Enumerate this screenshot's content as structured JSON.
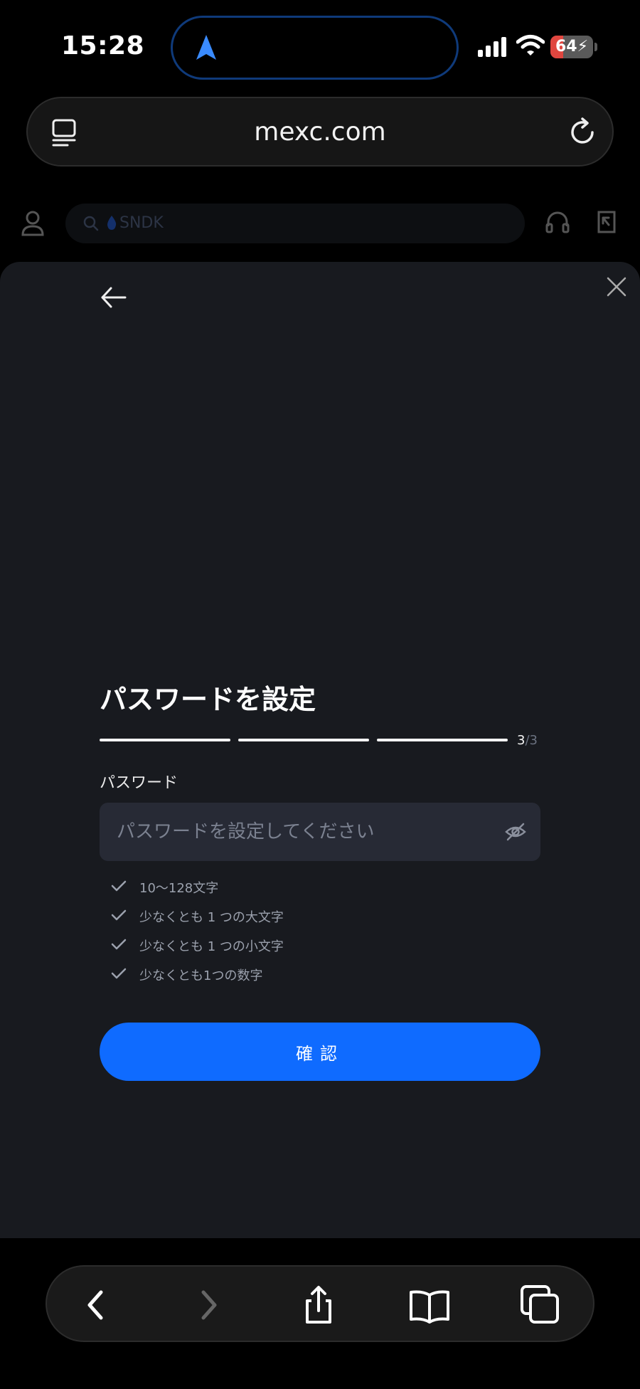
{
  "status_bar": {
    "time": "15:28",
    "battery": "64"
  },
  "browser": {
    "url": "mexc.com"
  },
  "site_header": {
    "search_hot_token": "SNDK"
  },
  "modal": {
    "title": "パスワードを設定",
    "step_current": "3",
    "step_total": "/3",
    "password_label": "パスワード",
    "password_placeholder": "パスワードを設定してください",
    "rules": [
      "10～128文字",
      "少なくとも 1 つの大文字",
      "少なくとも 1 つの小文字",
      "少なくとも1つの数字"
    ],
    "confirm_label": "確認"
  },
  "colors": {
    "accent": "#0f6bff",
    "modal_bg": "#181a1f",
    "field_bg": "#272a35",
    "island_border": "#0f3a7a"
  },
  "icons": [
    "navigation-arrow-icon",
    "signal-icon",
    "wifi-icon",
    "battery-icon",
    "tab-overview-icon",
    "reload-icon",
    "user-icon",
    "search-icon",
    "flame-icon",
    "headset-icon",
    "login-icon",
    "back-arrow-icon",
    "close-icon",
    "eye-off-icon",
    "check-icon",
    "browser-back-icon",
    "browser-forward-icon",
    "share-icon",
    "bookmarks-icon",
    "tabs-icon"
  ]
}
